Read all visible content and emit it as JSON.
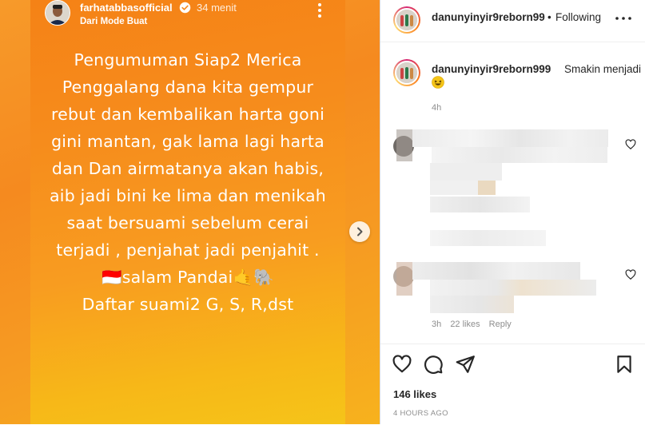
{
  "story": {
    "username": "farhatabbasofficial",
    "time": "34 menit",
    "subtitle": "Dari Mode Buat",
    "lines": [
      "Pengumuman Siap2  Merica",
      "Penggalang  dana kita gempur",
      "rebut  dan kembalikan harta goni",
      "gini  mantan, gak lama lagi harta",
      "dan   Dan airmatanya akan habis,",
      "aib jadi bini ke lima dan menikah",
      "saat  bersuami  sebelum cerai",
      "terjadi , penjahat jadi penjahit .",
      "🇮🇩salam Pandai🤙🐘",
      "Daftar  suami2    G, S, R,dst"
    ]
  },
  "post": {
    "header_username": "danunyinyir9reborn99",
    "header_dot": "•",
    "follow_status": "Following",
    "caption_username": "danunyinyir9reborn999",
    "caption_text": "Smakin menjadi",
    "caption_time": "4h",
    "comment2_time": "3h",
    "comment2_likes": "22 likes",
    "comment2_reply": "Reply",
    "likes": "146 likes",
    "age": "4 HOURS AGO"
  },
  "icons": {
    "like": "heart-outline-icon",
    "comment": "speech-bubble-icon",
    "share": "paper-plane-icon",
    "save": "bookmark-icon",
    "next": "chevron-right-icon"
  },
  "colors": {
    "story_top": "#f58216",
    "story_bottom": "#f5c419",
    "text_primary": "#262626",
    "text_secondary": "#8e8e8e"
  }
}
